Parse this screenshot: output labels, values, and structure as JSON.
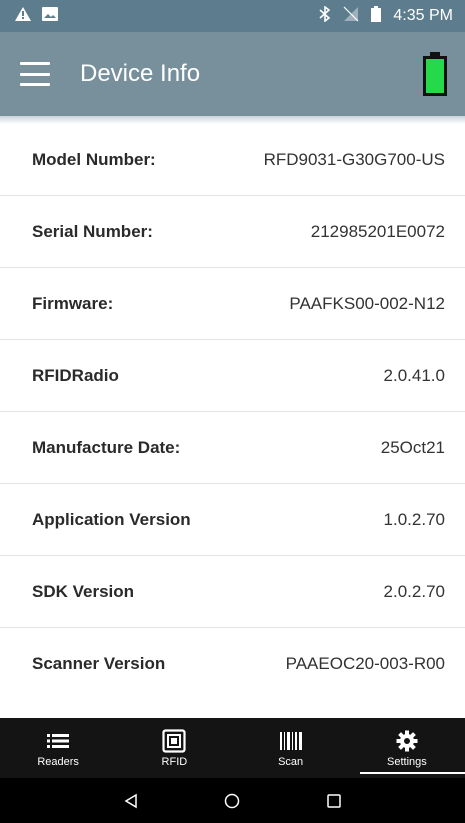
{
  "status_bar": {
    "time": "4:35 PM",
    "left_icons": [
      "warning-icon",
      "image-icon"
    ],
    "right_icons": [
      "bluetooth-icon",
      "no-signal-icon",
      "battery-icon"
    ]
  },
  "app_bar": {
    "title": "Device Info",
    "battery_color": "#26d94a"
  },
  "device_info": [
    {
      "label": "Model Number:",
      "value": "RFD9031-G30G700-US"
    },
    {
      "label": "Serial Number:",
      "value": "212985201E0072"
    },
    {
      "label": "Firmware:",
      "value": "PAAFKS00-002-N12"
    },
    {
      "label": "RFIDRadio",
      "value": "2.0.41.0"
    },
    {
      "label": "Manufacture Date:",
      "value": "25Oct21"
    },
    {
      "label": "Application Version",
      "value": "1.0.2.70"
    },
    {
      "label": "SDK Version",
      "value": "2.0.2.70"
    },
    {
      "label": "Scanner Version",
      "value": "PAAEOC20-003-R00"
    }
  ],
  "bottom_nav": {
    "items": [
      {
        "label": "Readers",
        "icon": "list-icon"
      },
      {
        "label": "RFID",
        "icon": "rfid-icon"
      },
      {
        "label": "Scan",
        "icon": "barcode-icon"
      },
      {
        "label": "Settings",
        "icon": "gear-icon",
        "active": true
      }
    ]
  },
  "colors": {
    "status_bar": "#5d7d8e",
    "app_bar": "#78909c",
    "bottom_nav": "#141414"
  }
}
